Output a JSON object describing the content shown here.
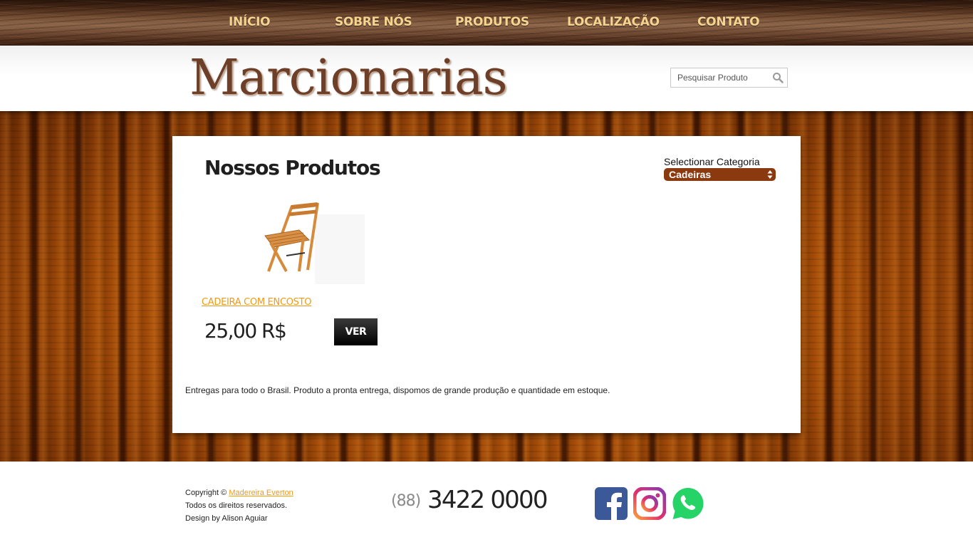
{
  "nav": {
    "items": [
      {
        "label": "INÍCIO"
      },
      {
        "label": "SOBRE NÓS"
      },
      {
        "label": "PRODUTOS"
      },
      {
        "label": "LOCALIZAÇÃO"
      },
      {
        "label": "CONTATO"
      }
    ]
  },
  "header": {
    "logo_text": "Marcionarias",
    "search_placeholder": "Pesquisar Produto"
  },
  "main": {
    "title": "Nossos Produtos",
    "category_label": "Selectionar Categoria",
    "category_selected": "Cadeiras",
    "products": [
      {
        "name": "CADEIRA COM ENCOSTO",
        "price": "25,00 R$",
        "button_label": "VER"
      }
    ],
    "delivery_text": "Entregas para todo o Brasil. Produto a pronta entrega, dispomos de grande produção e quantidade em estoque."
  },
  "footer": {
    "copyright_prefix": "Copyright ©",
    "copyright_link": "Madereira Everton",
    "rights": "Todos os direitos reservados.",
    "design": "Design by Alison Aguiar",
    "phone_area": "(88)",
    "phone_number": "3422 0000",
    "social": [
      {
        "icon": "facebook-icon",
        "color": "#3b5998"
      },
      {
        "icon": "instagram-icon",
        "color": "#c13584"
      },
      {
        "icon": "whatsapp-icon",
        "color": "#25d366"
      }
    ]
  },
  "colors": {
    "nav_text": "#f5d490",
    "accent_orange": "#f09a14",
    "select_bg": "#8b3a10",
    "logo_brown": "#6d3f28"
  }
}
